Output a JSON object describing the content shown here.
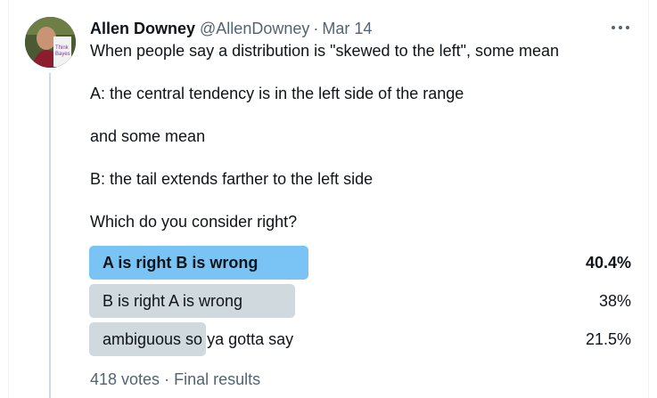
{
  "tweet": {
    "author_name": "Allen Downey",
    "handle": "@AllenDowney",
    "separator": "·",
    "date": "Mar 14",
    "avatar_book_text": [
      "Think",
      "Bayes"
    ],
    "lines": [
      "When people say a distribution is \"skewed to the left\", some mean",
      "A: the central tendency is in the left side of the range",
      "and some mean",
      "B: the tail extends farther to the left side",
      "Which do you consider right?"
    ]
  },
  "poll": {
    "options": [
      {
        "label": "A is right B is wrong",
        "percent_text": "40.4%",
        "percent": 40.4,
        "winner": true
      },
      {
        "label": "B is right A is wrong",
        "percent_text": "38%",
        "percent": 38,
        "winner": false
      },
      {
        "label": "ambiguous so ya gotta say",
        "percent_text": "21.5%",
        "percent": 21.5,
        "winner": false
      }
    ],
    "votes": "418 votes",
    "separator": "·",
    "status": "Final results"
  },
  "colors": {
    "winner_bar": "#79c4f5",
    "bar": "#cfd9de",
    "muted_text": "#536471"
  }
}
